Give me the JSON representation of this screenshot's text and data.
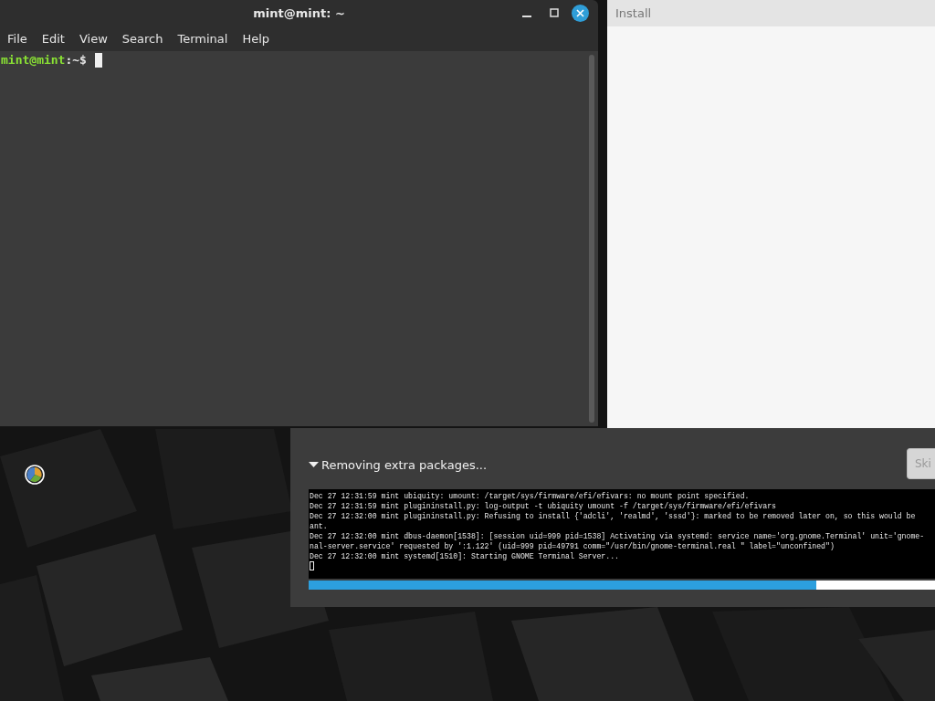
{
  "terminal": {
    "title": "mint@mint: ~",
    "menu": [
      "File",
      "Edit",
      "View",
      "Search",
      "Terminal",
      "Help"
    ],
    "prompt": {
      "user_host": "mint@mint",
      "path": ":~$"
    }
  },
  "install_window": {
    "title": "Install"
  },
  "install_progress": {
    "status": "Removing extra packages...",
    "expanded": true,
    "skip_button": "Ski",
    "log": [
      "Dec 27 12:31:59 mint ubiquity: umount: /target/sys/firmware/efi/efivars: no mount point specified.",
      "Dec 27 12:31:59 mint plugininstall.py: log-output -t ubiquity umount -f /target/sys/firmware/efi/efivars",
      "Dec 27 12:32:00 mint plugininstall.py: Refusing to install {'adcli', 'realmd', 'sssd'}: marked to be removed later on, so this would be",
      "ant.",
      "Dec 27 12:32:00 mint dbus-daemon[1538]: [session uid=999 pid=1538] Activating via systemd: service name='org.gnome.Terminal' unit='gnome-",
      "nal-server.service' requested by ':1.122' (uid=999 pid=49791 comm=\"/usr/bin/gnome-terminal.real \" label=\"unconfined\")",
      "Dec 27 12:32:00 mint systemd[1510]: Starting GNOME Terminal Server..."
    ],
    "level": 0.81
  }
}
